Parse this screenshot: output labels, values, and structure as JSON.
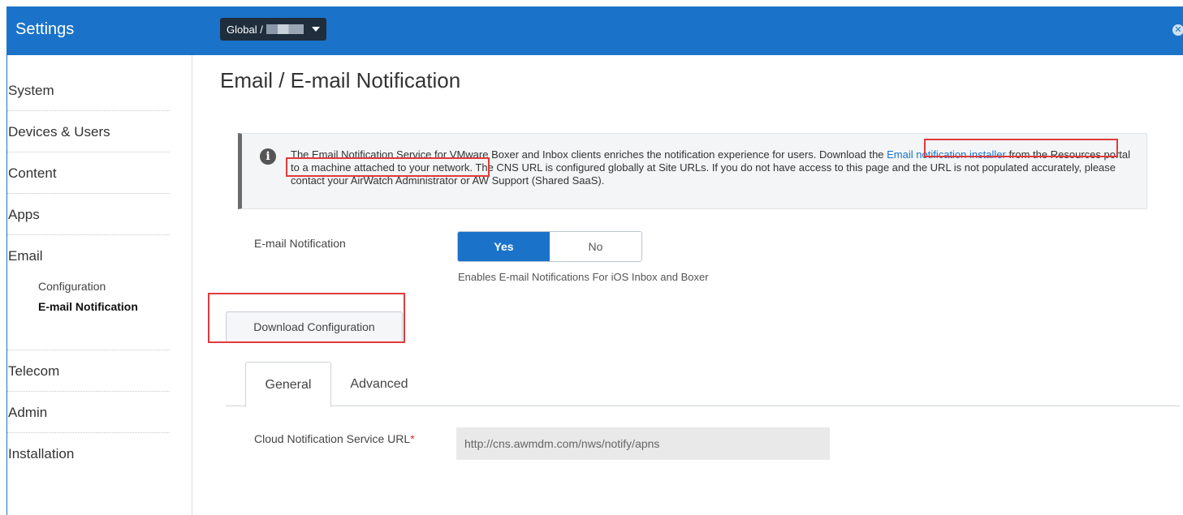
{
  "header": {
    "app_title": "Settings",
    "org_prefix": "Global /",
    "close_label": "✕"
  },
  "sidebar": {
    "items": [
      {
        "label": "System"
      },
      {
        "label": "Devices & Users"
      },
      {
        "label": "Content"
      },
      {
        "label": "Apps"
      },
      {
        "label": "Email"
      },
      {
        "label": "Telecom"
      },
      {
        "label": "Admin"
      },
      {
        "label": "Installation"
      }
    ],
    "email_sub": [
      {
        "label": "Configuration"
      },
      {
        "label": "E-mail Notification"
      }
    ]
  },
  "main": {
    "title": "Email / E-mail Notification",
    "info": {
      "text_1": "The Email Notification Service for VMware Boxer and Inbox clients enriches the notification experience for users. Download the ",
      "link": "Email notification installer",
      "text_2": " from the Resources portal to a machine attached to your network. The CNS URL is configured globally at Site URLs. If you do not have access to this page and the URL is not populated accurately, please contact your AirWatch Administrator or AW Support (Shared SaaS)."
    },
    "email_notification": {
      "label": "E-mail Notification",
      "yes": "Yes",
      "no": "No",
      "helper": "Enables E-mail Notifications For iOS Inbox and Boxer"
    },
    "download_button": "Download Configuration",
    "tabs": [
      {
        "label": "General"
      },
      {
        "label": "Advanced"
      }
    ],
    "cns": {
      "label": "Cloud Notification Service URL",
      "required": "*",
      "value": "http://cns.awmdm.com/nws/notify/apns"
    }
  },
  "colors": {
    "brand_blue": "#1a73c9",
    "highlight_red": "#e03b3b"
  }
}
